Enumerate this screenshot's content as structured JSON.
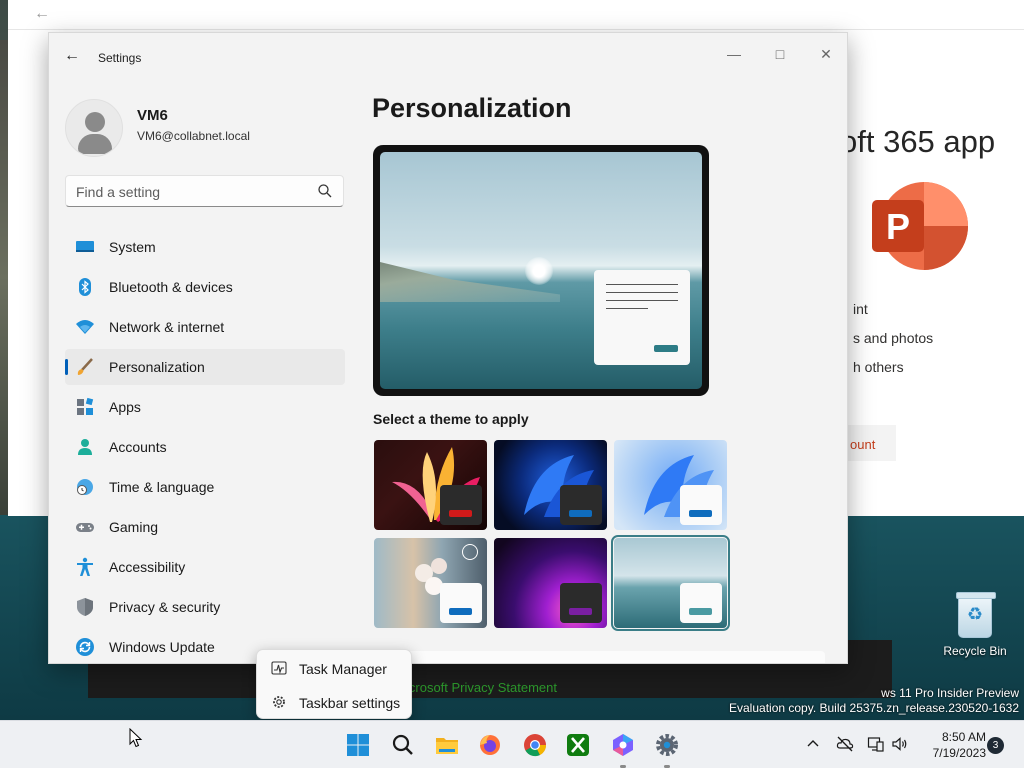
{
  "browser": {
    "title": "oft 365 app",
    "items": [
      "int",
      "s and photos",
      "h others"
    ],
    "button_label": "ount",
    "privacy_link": "icrosoft Privacy Statement"
  },
  "desktop": {
    "recycle_bin_label": "Recycle Bin",
    "watermark_line1": "ws 11 Pro Insider Preview",
    "watermark_line2": "Evaluation copy. Build 25375.zn_release.230520-1632"
  },
  "settings": {
    "window_title": "Settings",
    "user": {
      "name": "VM6",
      "email": "VM6@collabnet.local"
    },
    "search": {
      "placeholder": "Find a setting"
    },
    "nav": [
      {
        "label": "System",
        "icon": "monitor-icon"
      },
      {
        "label": "Bluetooth & devices",
        "icon": "bluetooth-icon"
      },
      {
        "label": "Network & internet",
        "icon": "wifi-icon"
      },
      {
        "label": "Personalization",
        "icon": "brush-icon",
        "active": true
      },
      {
        "label": "Apps",
        "icon": "apps-icon"
      },
      {
        "label": "Accounts",
        "icon": "person-icon"
      },
      {
        "label": "Time & language",
        "icon": "globe-clock-icon"
      },
      {
        "label": "Gaming",
        "icon": "gamepad-icon"
      },
      {
        "label": "Accessibility",
        "icon": "accessibility-icon"
      },
      {
        "label": "Privacy & security",
        "icon": "shield-icon"
      },
      {
        "label": "Windows Update",
        "icon": "update-icon"
      }
    ],
    "page_title": "Personalization",
    "theme_label": "Select a theme to apply",
    "themes": [
      {
        "name": "glow",
        "accent": "#d11a1a"
      },
      {
        "name": "windows-dark",
        "accent": "#0f6cbd"
      },
      {
        "name": "windows-light",
        "accent": "#0f6cbd"
      },
      {
        "name": "captured-motion",
        "accent": "#0f6cbd"
      },
      {
        "name": "sunrise",
        "accent": "#7a1fa2"
      },
      {
        "name": "flow",
        "accent": "#4a9aa2",
        "selected": true
      }
    ]
  },
  "context_menu": {
    "items": [
      {
        "label": "Task Manager",
        "icon": "task-manager-icon"
      },
      {
        "label": "Taskbar settings",
        "icon": "gear-icon"
      }
    ]
  },
  "taskbar": {
    "apps": [
      "start-icon",
      "search-icon",
      "file-explorer-icon",
      "firefox-icon",
      "chrome-icon",
      "xbox-icon",
      "copilot-icon",
      "settings-icon"
    ],
    "time": "8:50 AM",
    "date": "7/19/2023",
    "notification_count": "3"
  }
}
